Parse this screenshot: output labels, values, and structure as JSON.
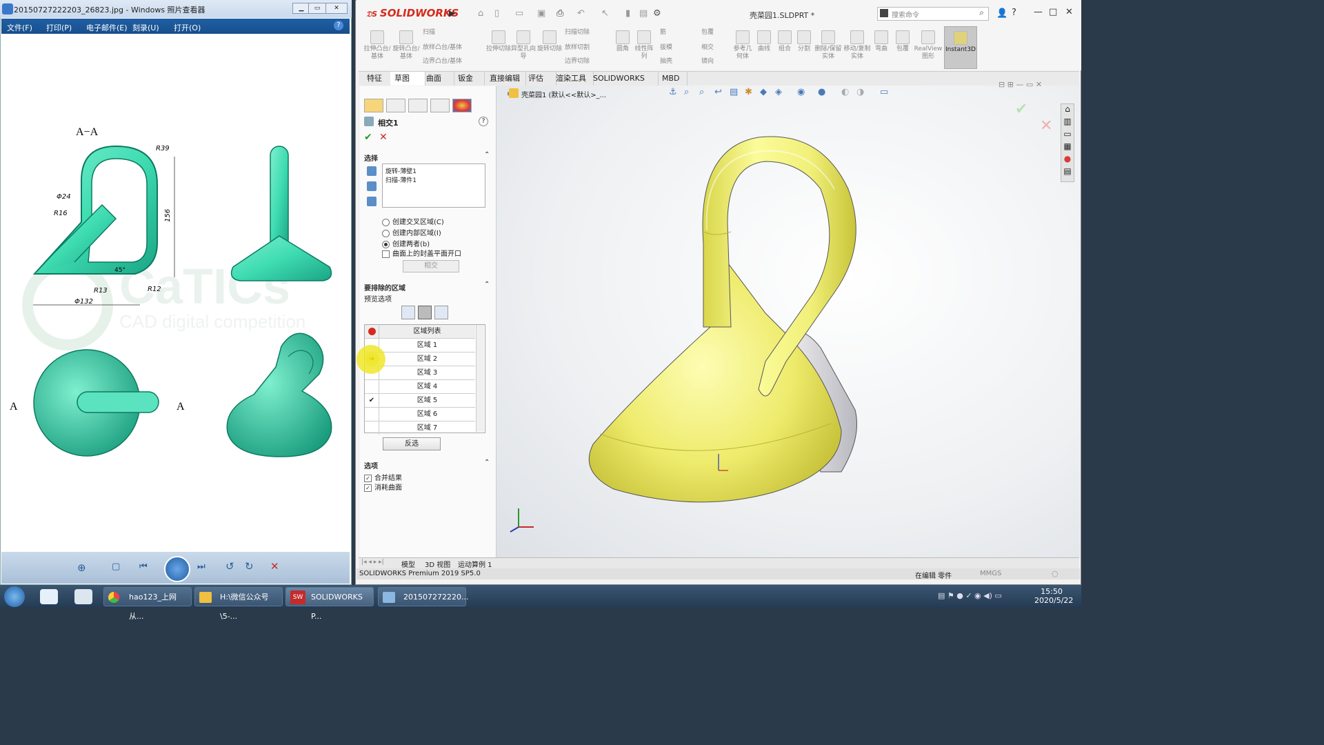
{
  "photo_viewer": {
    "title": "20150727222203_26823.jpg - Windows 照片查看器",
    "menu": [
      "文件(F)",
      "打印(P)",
      "电子邮件(E)",
      "刻录(U)",
      "打开(O)"
    ],
    "drawing": {
      "section_label": "A−A",
      "dims": [
        "R39",
        "Φ24",
        "R16",
        "156",
        "45°",
        "R13",
        "R12",
        "Φ132"
      ],
      "watermark_main": "CaTICs",
      "watermark_sub": "CAD digital competition",
      "label_a_left": "A",
      "label_a_right": "A"
    }
  },
  "solidworks": {
    "brand": "SOLIDWORKS",
    "doc_title": "壳菜园1.SLDPRT *",
    "search_placeholder": "搜索命令",
    "ribbon": [
      "拉伸凸台/基体",
      "旋转凸台/基体",
      "扫描",
      "放样凸台/基体",
      "边界凸台/基体",
      "拉伸切除",
      "异型孔向导",
      "旋转切除",
      "扫描切除",
      "放样切割",
      "边界切除",
      "圆角",
      "线性阵列",
      "筋",
      "拔模",
      "抽壳",
      "包覆",
      "相交",
      "镜向",
      "参考几何体",
      "曲线",
      "组合",
      "分割",
      "删除/保留实体",
      "移动/复制实体",
      "弯曲",
      "包覆",
      "RealView图形",
      "Instant3D"
    ],
    "tabs": [
      "特征",
      "草图",
      "曲面",
      "钣金",
      "直接编辑",
      "评估",
      "渲染工具",
      "SOLIDWORKS 插件",
      "MBD"
    ],
    "feature_tree_item": "壳菜园1 (默认<<默认>_...",
    "property_manager": {
      "title": "相交1",
      "section_select": "选择",
      "selections": [
        "旋转-薄壁1",
        "扫描-薄件1"
      ],
      "radio_options": [
        "创建交叉区域(C)",
        "创建内部区域(I)",
        "创建两者(b)"
      ],
      "radio_selected": 2,
      "checkbox_cap": "曲面上的封盖平面开口",
      "intersect_button": "相交",
      "section_exclude": "要排除的区域",
      "preview_options": "预览选项",
      "region_list_header": "区域列表",
      "regions": [
        "区域 1",
        "区域 2",
        "区域 3",
        "区域 4",
        "区域 5",
        "区域 6",
        "区域 7"
      ],
      "region_checked": [
        false,
        false,
        false,
        false,
        true,
        false,
        false
      ],
      "reverse_button": "反选",
      "section_options": "选项",
      "option_merge": "合并结果",
      "option_consume": "消耗曲面"
    },
    "bottom_tabs": [
      "模型",
      "3D 视图",
      "运动算例 1"
    ],
    "status_left": "SOLIDWORKS Premium 2019 SP5.0",
    "status_mid": "在编辑 零件",
    "status_units": "MMGS"
  },
  "taskbar": {
    "items": [
      "hao123_上网从...",
      "H:\\微信公众号\\5-...",
      "SOLIDWORKS P...",
      "201507272220..."
    ],
    "time": "15:50",
    "date": "2020/5/22"
  },
  "colors": {
    "part_yellow": "#efef74",
    "drawing_green": "#3fdcb2",
    "sw_red": "#d52b1e",
    "taskbar_blue": "#2e4660"
  }
}
